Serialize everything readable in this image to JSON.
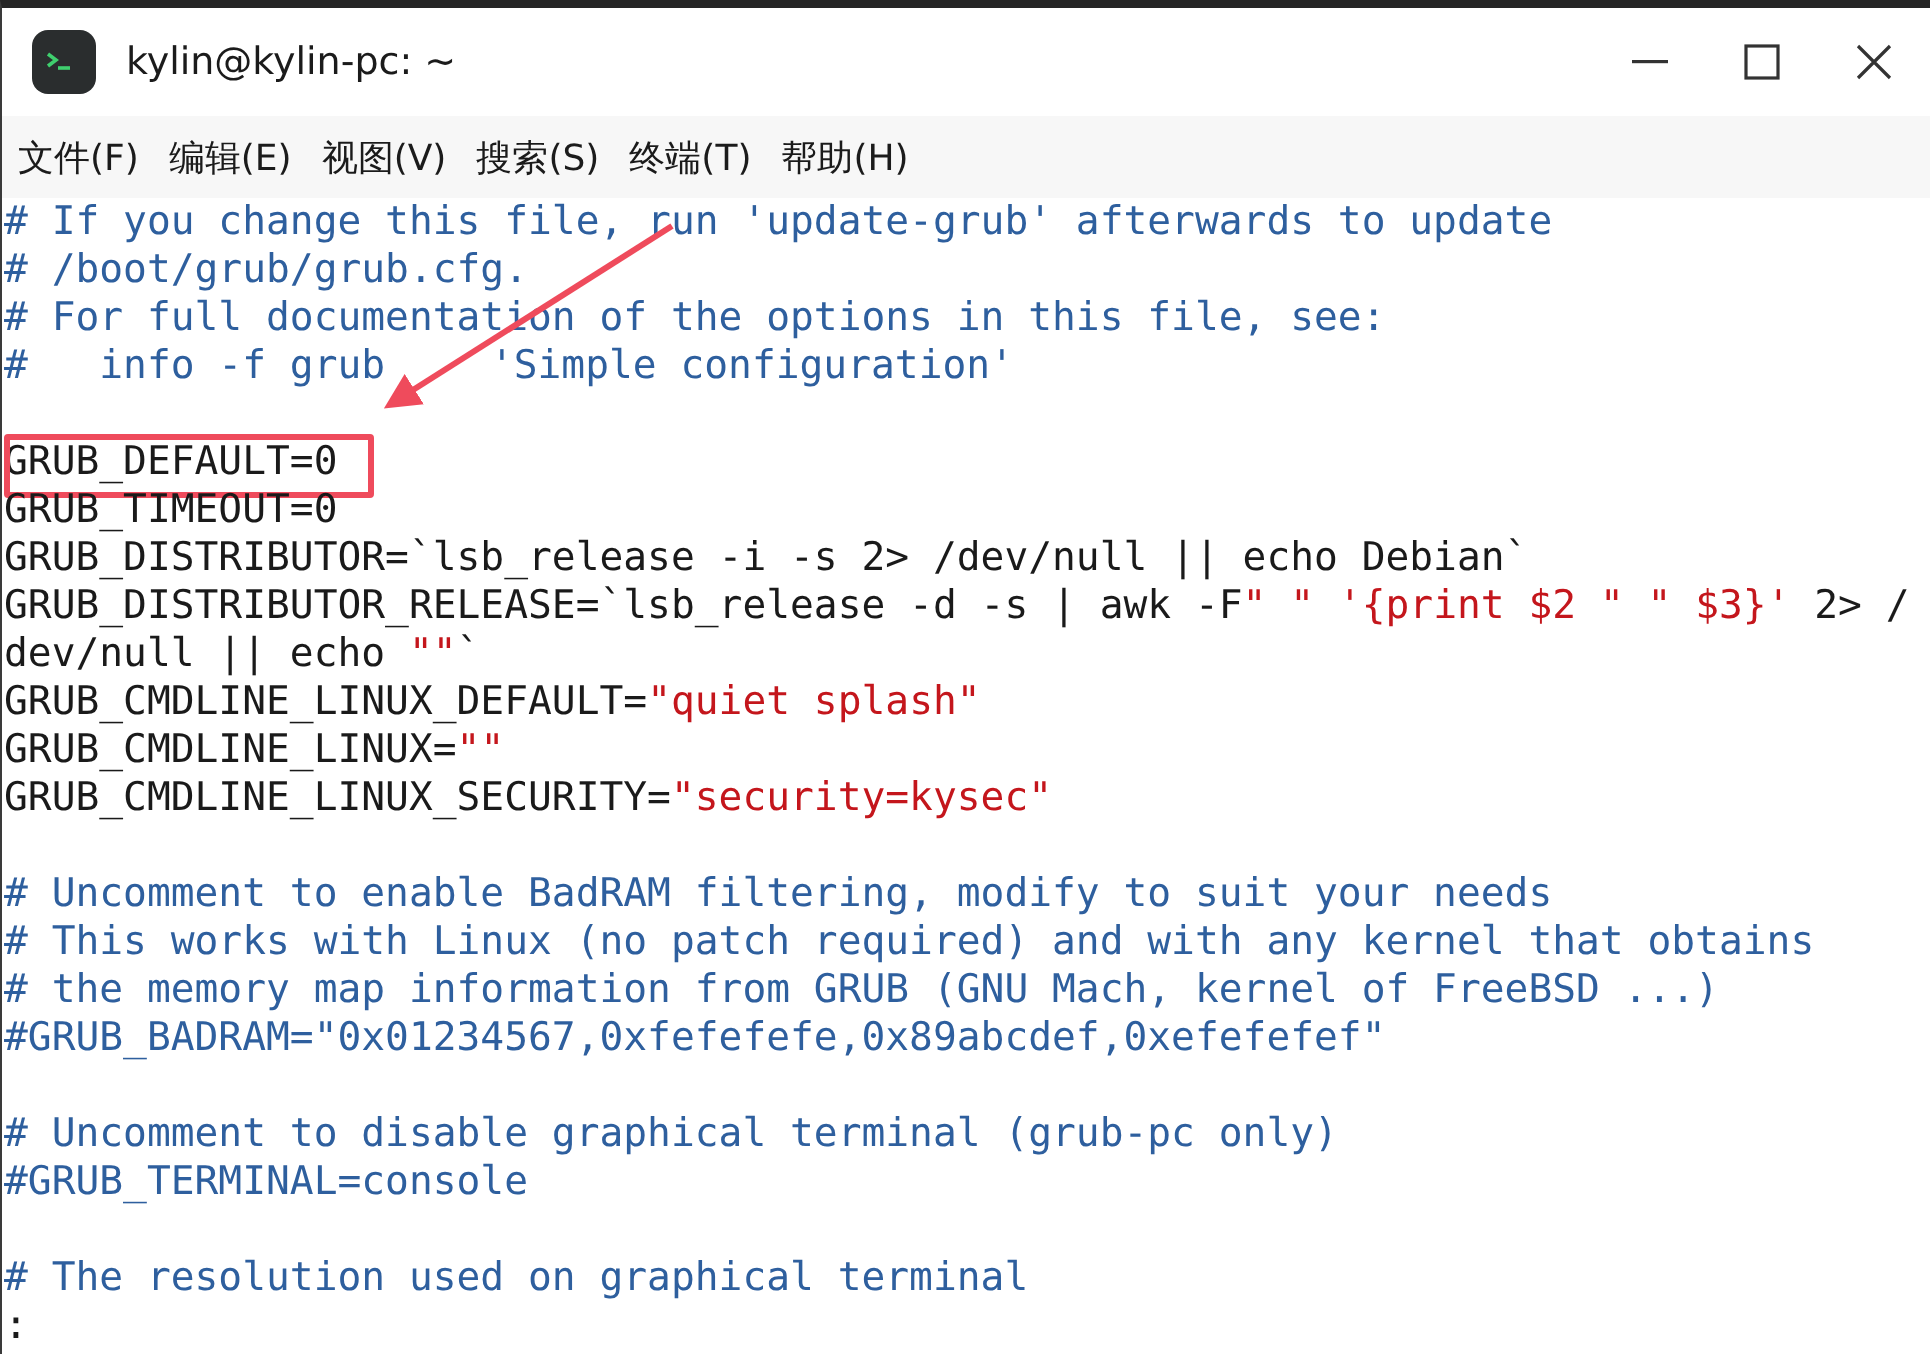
{
  "window": {
    "title": "kylin@kylin-pc: ~"
  },
  "menu": [
    "文件(F)",
    "编辑(E)",
    "视图(V)",
    "搜索(S)",
    "终端(T)",
    "帮助(H)"
  ],
  "terminal": {
    "lines": [
      {
        "kind": "code",
        "highlighted": false,
        "segments": [
          {
            "kind": "comment",
            "text": "# If you change this file, run 'update-grub' afterwards to update"
          }
        ]
      },
      {
        "kind": "code",
        "highlighted": false,
        "segments": [
          {
            "kind": "comment",
            "text": "# /boot/grub/grub.cfg."
          }
        ]
      },
      {
        "kind": "code",
        "highlighted": false,
        "segments": [
          {
            "kind": "comment",
            "text": "# For full documentation of the options in this file, see:"
          }
        ]
      },
      {
        "kind": "code",
        "highlighted": false,
        "segments": [
          {
            "kind": "comment",
            "text": "#   info -f grub"
          },
          {
            "kind": "covered"
          },
          {
            "kind": "comment",
            "text": "'Simple configuration'"
          }
        ]
      },
      {
        "kind": "blank"
      },
      {
        "kind": "code",
        "highlighted": true,
        "segments": [
          {
            "kind": "plain",
            "text": "GRUB_DEFAULT=0"
          }
        ]
      },
      {
        "kind": "code",
        "highlighted": false,
        "segments": [
          {
            "kind": "plain",
            "text": "GRUB_TIMEOUT=0"
          }
        ]
      },
      {
        "kind": "code",
        "highlighted": false,
        "segments": [
          {
            "kind": "plain",
            "text": "GRUB_DISTRIBUTOR=`lsb_release -i -s 2> /dev/null || echo Debian`"
          }
        ]
      },
      {
        "kind": "code",
        "highlighted": false,
        "segments": [
          {
            "kind": "plain",
            "text": "GRUB_DISTRIBUTOR_RELEASE=`lsb_release -d -s | awk -F"
          },
          {
            "kind": "string",
            "text": "\" \""
          },
          {
            "kind": "string",
            "text": " '{print $2 \" \" $3}'"
          },
          {
            "kind": "plain",
            "text": " 2> /"
          }
        ]
      },
      {
        "kind": "code",
        "highlighted": false,
        "segments": [
          {
            "kind": "plain",
            "text": "dev/null || echo "
          },
          {
            "kind": "string",
            "text": "\"\""
          },
          {
            "kind": "plain",
            "text": "`"
          }
        ]
      },
      {
        "kind": "code",
        "highlighted": false,
        "segments": [
          {
            "kind": "plain",
            "text": "GRUB_CMDLINE_LINUX_DEFAULT="
          },
          {
            "kind": "string",
            "text": "\"quiet splash\""
          }
        ]
      },
      {
        "kind": "code",
        "highlighted": false,
        "segments": [
          {
            "kind": "plain",
            "text": "GRUB_CMDLINE_LINUX="
          },
          {
            "kind": "string",
            "text": "\"\""
          }
        ]
      },
      {
        "kind": "code",
        "highlighted": false,
        "segments": [
          {
            "kind": "plain",
            "text": "GRUB_CMDLINE_LINUX_SECURITY="
          },
          {
            "kind": "string",
            "text": "\"security=kysec\""
          }
        ]
      },
      {
        "kind": "blank"
      },
      {
        "kind": "code",
        "highlighted": false,
        "segments": [
          {
            "kind": "comment",
            "text": "# Uncomment to enable BadRAM filtering, modify to suit your needs"
          }
        ]
      },
      {
        "kind": "code",
        "highlighted": false,
        "segments": [
          {
            "kind": "comment",
            "text": "# This works with Linux (no patch required) and with any kernel that obtains"
          }
        ]
      },
      {
        "kind": "code",
        "highlighted": false,
        "segments": [
          {
            "kind": "comment",
            "text": "# the memory map information from GRUB (GNU Mach, kernel of FreeBSD ...)"
          }
        ]
      },
      {
        "kind": "code",
        "highlighted": false,
        "segments": [
          {
            "kind": "comment",
            "text": "#GRUB_BADRAM=\"0x01234567,0xfefefefe,0x89abcdef,0xefefefef\""
          }
        ]
      },
      {
        "kind": "blank"
      },
      {
        "kind": "code",
        "highlighted": false,
        "segments": [
          {
            "kind": "comment",
            "text": "# Uncomment to disable graphical terminal (grub-pc only)"
          }
        ]
      },
      {
        "kind": "code",
        "highlighted": false,
        "segments": [
          {
            "kind": "comment",
            "text": "#GRUB_TERMINAL=console"
          }
        ]
      },
      {
        "kind": "blank"
      },
      {
        "kind": "code",
        "highlighted": false,
        "segments": [
          {
            "kind": "comment",
            "text": "# The resolution used on graphical terminal"
          }
        ]
      },
      {
        "kind": "prompt",
        "text": ":"
      }
    ]
  }
}
